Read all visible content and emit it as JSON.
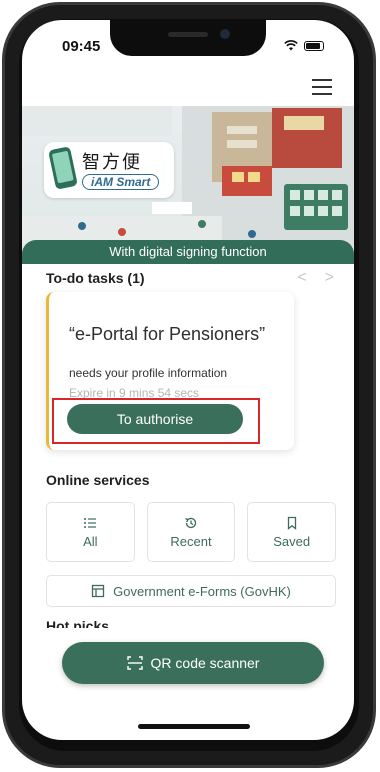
{
  "status_bar": {
    "time": "09:45"
  },
  "hero": {
    "logo_cn": "智方便",
    "logo_en": "iAM Smart",
    "banner": "With digital signing function"
  },
  "todo": {
    "title": "To-do tasks (1)",
    "prev_arrow": "<",
    "next_arrow": ">",
    "card": {
      "title": "“e-Portal for Pensioners”",
      "description": "needs your profile information",
      "expire": "Expire in 9 mins 54 secs",
      "button": "To authorise"
    }
  },
  "online_services": {
    "title": "Online services",
    "buttons": [
      {
        "label": "All",
        "icon": "list-icon"
      },
      {
        "label": "Recent",
        "icon": "history-icon"
      },
      {
        "label": "Saved",
        "icon": "bookmark-icon"
      }
    ],
    "forms_button": {
      "label": "Government e-Forms (GovHK)",
      "icon": "form-icon"
    }
  },
  "hot_picks": {
    "title": "Hot picks"
  },
  "qr_button": {
    "label": "QR code scanner",
    "icon": "qr-scan-icon"
  },
  "colors": {
    "primary": "#3a6f5c",
    "accent_bar": "#e7b93a",
    "highlight": "#d8262b"
  }
}
